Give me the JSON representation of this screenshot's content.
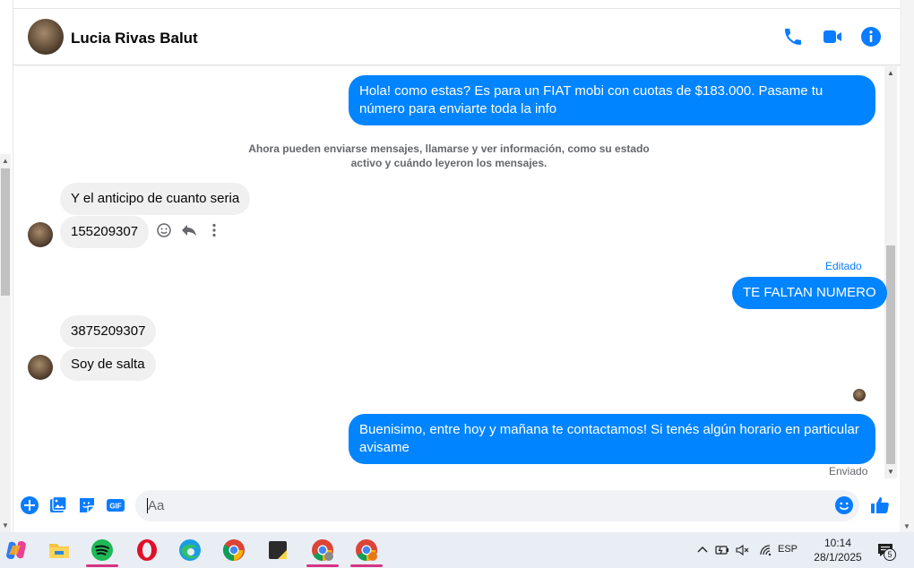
{
  "contact": {
    "name": "Lucia Rivas Balut"
  },
  "header_actions": {
    "call": "phone-icon",
    "video": "video-camera-icon",
    "info": "info-icon"
  },
  "messages": {
    "m1": "Hola! como estas? Es para un FIAT mobi con cuotas de $183.000. Pasame tu número para enviarte toda la info",
    "system_note": "Ahora pueden enviarse mensajes, llamarse y ver información, como su estado activo y cuándo leyeron los mensajes.",
    "m2": "Y el anticipo de cuanto seria",
    "m3": "155209307",
    "m4_meta": "Editado",
    "m4": "TE FALTAN NUMERO",
    "m5": "3875209307",
    "m6": "Soy de salta",
    "m7": "Buenisimo, entre hoy y mañana te contactamos! Si tenés algún horario en particular avisame",
    "m7_status": "Enviado"
  },
  "message_actions": [
    "smiley-react-icon",
    "reply-icon",
    "more-vertical-icon"
  ],
  "composer": {
    "placeholder": "Aa",
    "value": "",
    "icons": [
      "plus-circle-icon",
      "image-icon",
      "sticker-icon",
      "gif-icon",
      "emoji-icon",
      "thumbs-up-icon"
    ],
    "gif_label": "GIF"
  },
  "colors": {
    "accent": "#0084ff",
    "incoming_bubble": "#f0f0f0",
    "taskbar": "#e9eef5"
  },
  "taskbar": {
    "apps": [
      "copilot-icon",
      "file-explorer-icon",
      "spotify-icon",
      "opera-icon",
      "edge-icon",
      "chrome-icon",
      "sticky-notes-icon",
      "chrome-profile-icon",
      "chrome-profile-icon"
    ],
    "language": "ESP",
    "time": "10:14",
    "date": "28/1/2025",
    "notification_count": "5"
  }
}
